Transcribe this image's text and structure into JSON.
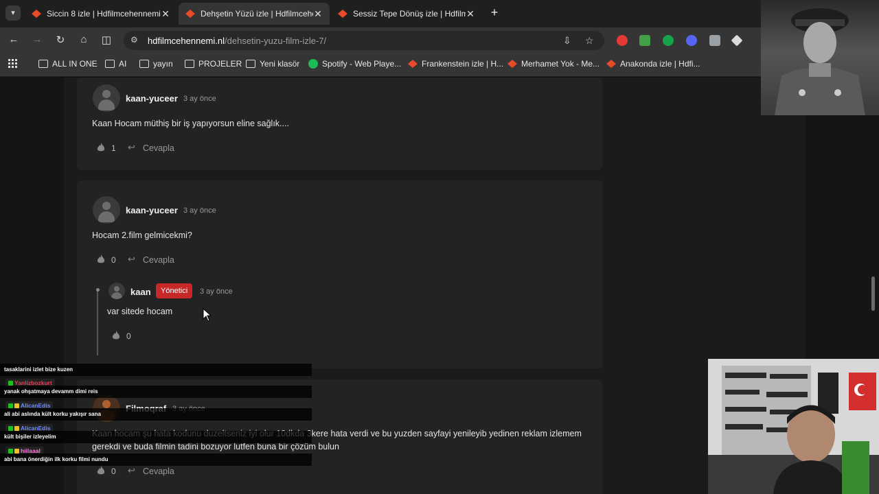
{
  "tabs": [
    {
      "title": "Siccin 8 izle | Hdfilmcehennemi",
      "active": false
    },
    {
      "title": "Dehşetin Yüzü izle | Hdfilmcehe",
      "active": true
    },
    {
      "title": "Sessiz Tepe Dönüş izle | Hdfilmc",
      "active": false
    }
  ],
  "url": {
    "host": "hdfilmcehennemi.nl",
    "path": "/dehsetin-yuzu-film-izle-7/"
  },
  "bookmarks": [
    {
      "label": "",
      "icon": "apps-grid-icon"
    },
    {
      "label": "ALL IN ONE",
      "icon": "folder-icon"
    },
    {
      "label": "AI",
      "icon": "folder-icon"
    },
    {
      "label": "yayın",
      "icon": "folder-icon"
    },
    {
      "label": "PROJELER",
      "icon": "folder-icon"
    },
    {
      "label": "Yeni klasör",
      "icon": "folder-icon"
    },
    {
      "label": "Spotify - Web Playe...",
      "icon": "spotify-icon"
    },
    {
      "label": "Frankenstein izle | H...",
      "icon": "site-favicon"
    },
    {
      "label": "Merhamet Yok - Me...",
      "icon": "site-favicon"
    },
    {
      "label": "Anakonda izle | Hdfi...",
      "icon": "site-favicon"
    }
  ],
  "comments": [
    {
      "user": "kaan-yuceer",
      "time": "3 ay önce",
      "text": "Kaan Hocam müthiş bir iş yapıyorsun eline sağlık....",
      "likes": "1",
      "reply": "Cevapla"
    },
    {
      "user": "kaan-yuceer",
      "time": "3 ay önce",
      "text": "Hocam 2.film gelmicekmi?",
      "likes": "0",
      "reply": "Cevapla",
      "child": {
        "user": "kaan",
        "badge": "Yönetici",
        "time": "3 ay önce",
        "text": "var sitede hocam",
        "likes": "0"
      }
    },
    {
      "user": "Filmoqraf",
      "time": "3 ay önce",
      "text": "Kaan hocam şu hata kodunu duzeltseniz iyi olur 10dkda 3kere hata verdi ve bu yuzden sayfayi yenileyib yedinen reklam izlemem gerekdi ve buda filmin tadini bozuyor lutfen buna bir çözüm bulun",
      "likes": "0",
      "reply": "Cevapla"
    }
  ],
  "chat": [
    {
      "user": "",
      "msg": "tasaklarini izlet bize kuzen"
    },
    {
      "user": "Yanlizbozkurt",
      "msg": "yanak ohşatmaya devamm dimi reis",
      "color": "#e0405a"
    },
    {
      "user": "AlicanEdis",
      "msg": "ali abi aslında kült korku yakışır sana",
      "color": "#6f8cff"
    },
    {
      "user": "AlicanEdis",
      "msg": "kült bişiler izleyelim",
      "color": "#6f8cff"
    },
    {
      "user": "hiilaaal",
      "msg": "abi bana önerdiğin ilk korku filmi nundu",
      "color": "#ff7ad9"
    }
  ],
  "colors": {
    "accent_badge": "#c62828",
    "page_bg": "#151515",
    "card_bg": "#232323"
  }
}
